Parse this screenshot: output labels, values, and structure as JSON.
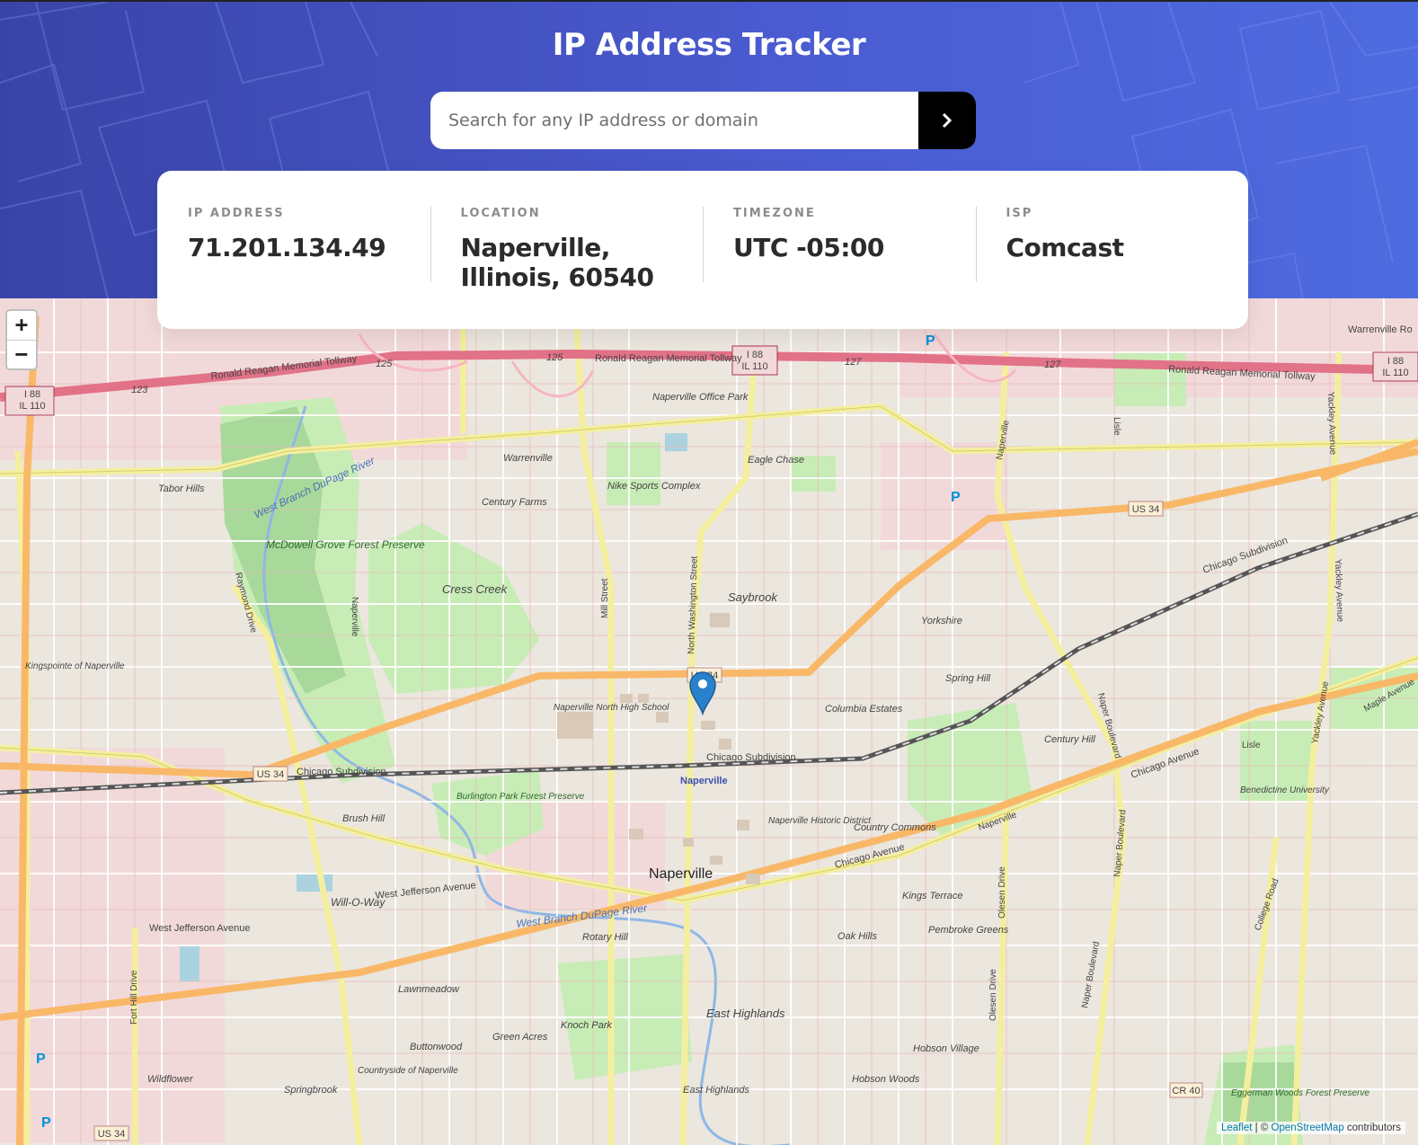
{
  "header": {
    "title": "IP Address Tracker",
    "search_placeholder": "Search for any IP address or domain",
    "search_value": ""
  },
  "info": {
    "ip_label": "IP ADDRESS",
    "ip_value": "71.201.134.49",
    "location_label": "LOCATION",
    "location_line1": "Naperville,",
    "location_line2": "Illinois, 60540",
    "timezone_label": "TIMEZONE",
    "timezone_value": "UTC -05:00",
    "isp_label": "ISP",
    "isp_value": "Comcast"
  },
  "map": {
    "zoom_in": "+",
    "zoom_out": "−",
    "attribution_leaflet": "Leaflet",
    "attribution_sep": " | © ",
    "attribution_osm": "OpenStreetMap",
    "attribution_tail": " contributors",
    "labels": {
      "tollway": "Ronald Reagan Memorial Tollway",
      "i88": "I 88",
      "il110": "IL 110",
      "us34": "US 34",
      "cr40": "CR 40",
      "exit123": "123",
      "exit125": "125",
      "exit127": "127",
      "warrenville": "Warrenville",
      "warrenville_road": "Warrenville Ro",
      "naperville_office_park": "Naperville Office Park",
      "nike_sports": "Nike Sports Complex",
      "century_farms": "Century Farms",
      "eagle_chase": "Eagle Chase",
      "tabor_hills": "Tabor Hills",
      "mcdowell": "McDowell Grove Forest Preserve",
      "west_branch": "West Branch DuPage River",
      "cress_creek": "Cress Creek",
      "saybrook": "Saybrook",
      "yorkshire": "Yorkshire",
      "spring_hill": "Spring Hill",
      "kingspointe": "Kingspointe of Naperville",
      "raymond": "Raymond Drive",
      "mill_street": "Mill Street",
      "washington": "North Washington Street",
      "naperville_north": "Naperville North High School",
      "columbia_estates": "Columbia Estates",
      "chicago_subdivision": "Chicago Subdivision",
      "naperville_station": "Naperville",
      "burlington": "Burlington Park Forest Preserve",
      "brush_hill": "Brush Hill",
      "naperville_historic": "Naperville Historic District",
      "country_commons": "Country Commons",
      "chicago_avenue": "Chicago Avenue",
      "naperville_city": "Naperville",
      "west_jefferson": "West Jefferson Avenue",
      "will_o_way": "Will-O-Way",
      "kings_terrace": "Kings Terrace",
      "pembroke": "Pembroke Greens",
      "oak_hills": "Oak Hills",
      "rotary_hill": "Rotary Hill",
      "lawnmeadow": "Lawnmeadow",
      "east_highlands": "East Highlands",
      "knoch_park": "Knoch Park",
      "green_acres": "Green Acres",
      "buttonwood": "Buttonwood",
      "countryside": "Countryside of Naperville",
      "springbrook": "Springbrook",
      "wildflower": "Wildflower",
      "hobson_village": "Hobson Village",
      "hobson_woods": "Hobson Woods",
      "olesen": "Olesen Drive",
      "naper_blvd": "Naper Boulevard",
      "college_road": "College Road",
      "century_hill": "Century Hill",
      "benedictine": "Benedictine University",
      "eggerman": "Eggerman Woods Forest Preserve",
      "yackley": "Yackley Avenue",
      "lisle": "Lisle",
      "maple": "Maple Avenue",
      "fort_hill": "Fort Hill Drive",
      "naperville_road": "Naperville",
      "parking": "P"
    }
  }
}
